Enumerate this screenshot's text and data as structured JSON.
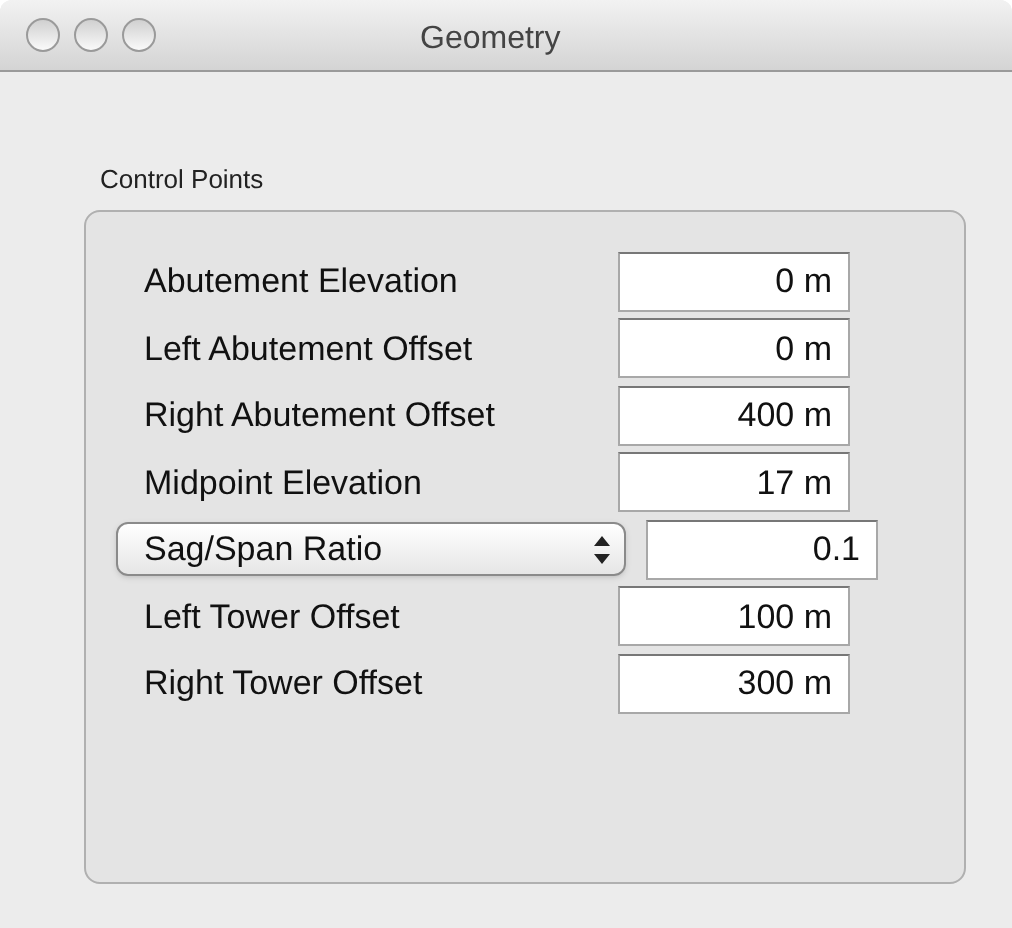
{
  "window": {
    "title": "Geometry"
  },
  "group": {
    "title": "Control Points",
    "rows": [
      {
        "kind": "label",
        "label": "Abutement Elevation",
        "value": "0 m"
      },
      {
        "kind": "label",
        "label": "Left Abutement Offset",
        "value": "0 m"
      },
      {
        "kind": "label",
        "label": "Right Abutement Offset",
        "value": "400 m"
      },
      {
        "kind": "label",
        "label": "Midpoint Elevation",
        "value": "17 m"
      },
      {
        "kind": "popup",
        "label": "Sag/Span Ratio",
        "value": "0.1"
      },
      {
        "kind": "label",
        "label": "Left Tower Offset",
        "value": "100 m"
      },
      {
        "kind": "label",
        "label": "Right Tower Offset",
        "value": "300 m"
      }
    ]
  }
}
